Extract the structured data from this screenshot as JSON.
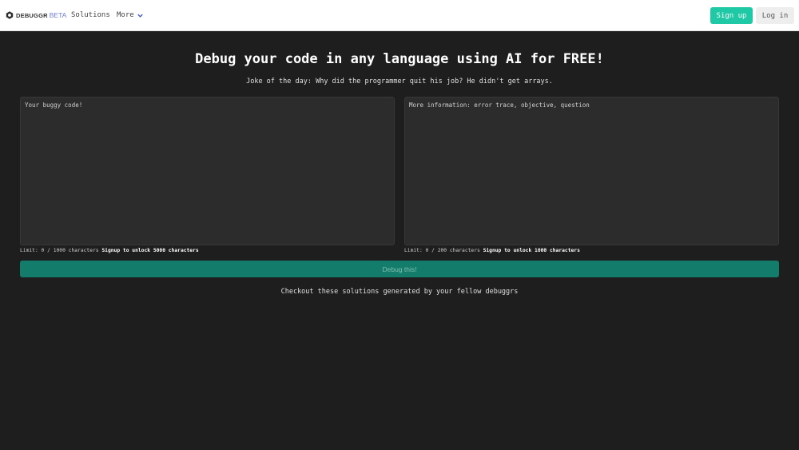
{
  "nav": {
    "brand_name": "DEBUGGR",
    "brand_badge": "BETA",
    "solutions_label": "Solutions",
    "more_label": "More",
    "signup_label": "Sign up",
    "login_label": "Log in",
    "colors": {
      "signup": "#1fc9a5",
      "badge": "#6f7bd6"
    }
  },
  "hero": {
    "title": "Debug your code in any language using AI for FREE!",
    "joke": "Joke of the day: Why did the programmer quit his job? He didn't get arrays."
  },
  "code_input": {
    "placeholder": "Your buggy code!",
    "value": "",
    "limit_text": "Limit: 0 / 1000 characters",
    "unlock_text": "Signup to unlock 5000 characters"
  },
  "info_input": {
    "placeholder": "More information: error trace, objective, question",
    "value": "",
    "limit_text": "Limit: 0 / 200 characters",
    "unlock_text": "Signup to unlock 1000 characters"
  },
  "debug_button": {
    "label": "Debug this!",
    "color": "#147c6a"
  },
  "footer": {
    "checkout_text": "Checkout these solutions generated by your fellow debuggrs"
  }
}
